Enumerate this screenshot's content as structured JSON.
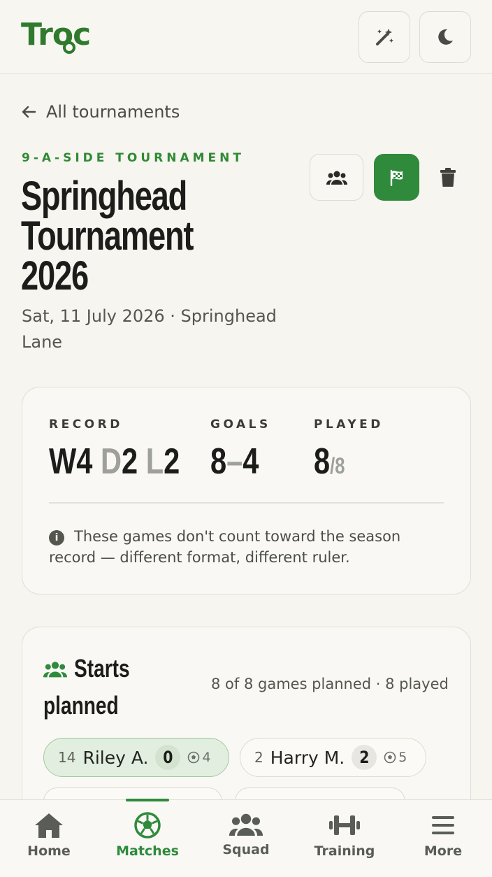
{
  "app": {
    "logo": "Troc"
  },
  "header": {
    "magic_icon": "magic-wand-icon",
    "theme_icon": "moon-icon"
  },
  "back_link": {
    "label": "All tournaments"
  },
  "tournament": {
    "eyebrow": "9-A-SIDE TOURNAMENT",
    "title_lines": [
      "Springhead",
      "Tournament",
      "2026"
    ],
    "subtitle": "Sat, 11 July 2026 · Springhead Lane"
  },
  "actions": {
    "squad_icon": "users-icon",
    "finish_icon": "checkered-flag-icon",
    "delete_icon": "trash-icon"
  },
  "summary": {
    "record_label": "RECORD",
    "record": {
      "w": "W4",
      "d": "D2",
      "l": "L2"
    },
    "goals_label": "GOALS",
    "goals": {
      "for": "8",
      "sep": "–",
      "against": "4"
    },
    "played_label": "PLAYED",
    "played": {
      "count": "8",
      "total": "/8"
    },
    "note": "These games don't count toward the season record — different format, different ruler."
  },
  "starts": {
    "title": "Starts planned",
    "meta": "8 of 8 games planned · 8 played",
    "players": [
      {
        "number": "14",
        "name": "Riley A.",
        "starts": "0",
        "games": "4",
        "selected": true
      },
      {
        "number": "2",
        "name": "Harry M.",
        "starts": "2",
        "games": "5",
        "selected": false
      }
    ]
  },
  "nav": [
    {
      "label": "Home",
      "icon": "home-icon"
    },
    {
      "label": "Matches",
      "icon": "soccer-ball-icon",
      "active": true
    },
    {
      "label": "Squad",
      "icon": "users-icon"
    },
    {
      "label": "Training",
      "icon": "dumbbell-icon"
    },
    {
      "label": "More",
      "icon": "menu-icon"
    }
  ],
  "colors": {
    "accent": "#2f8a3c",
    "background": "#f6f5f0",
    "text": "#1c1d1b"
  }
}
